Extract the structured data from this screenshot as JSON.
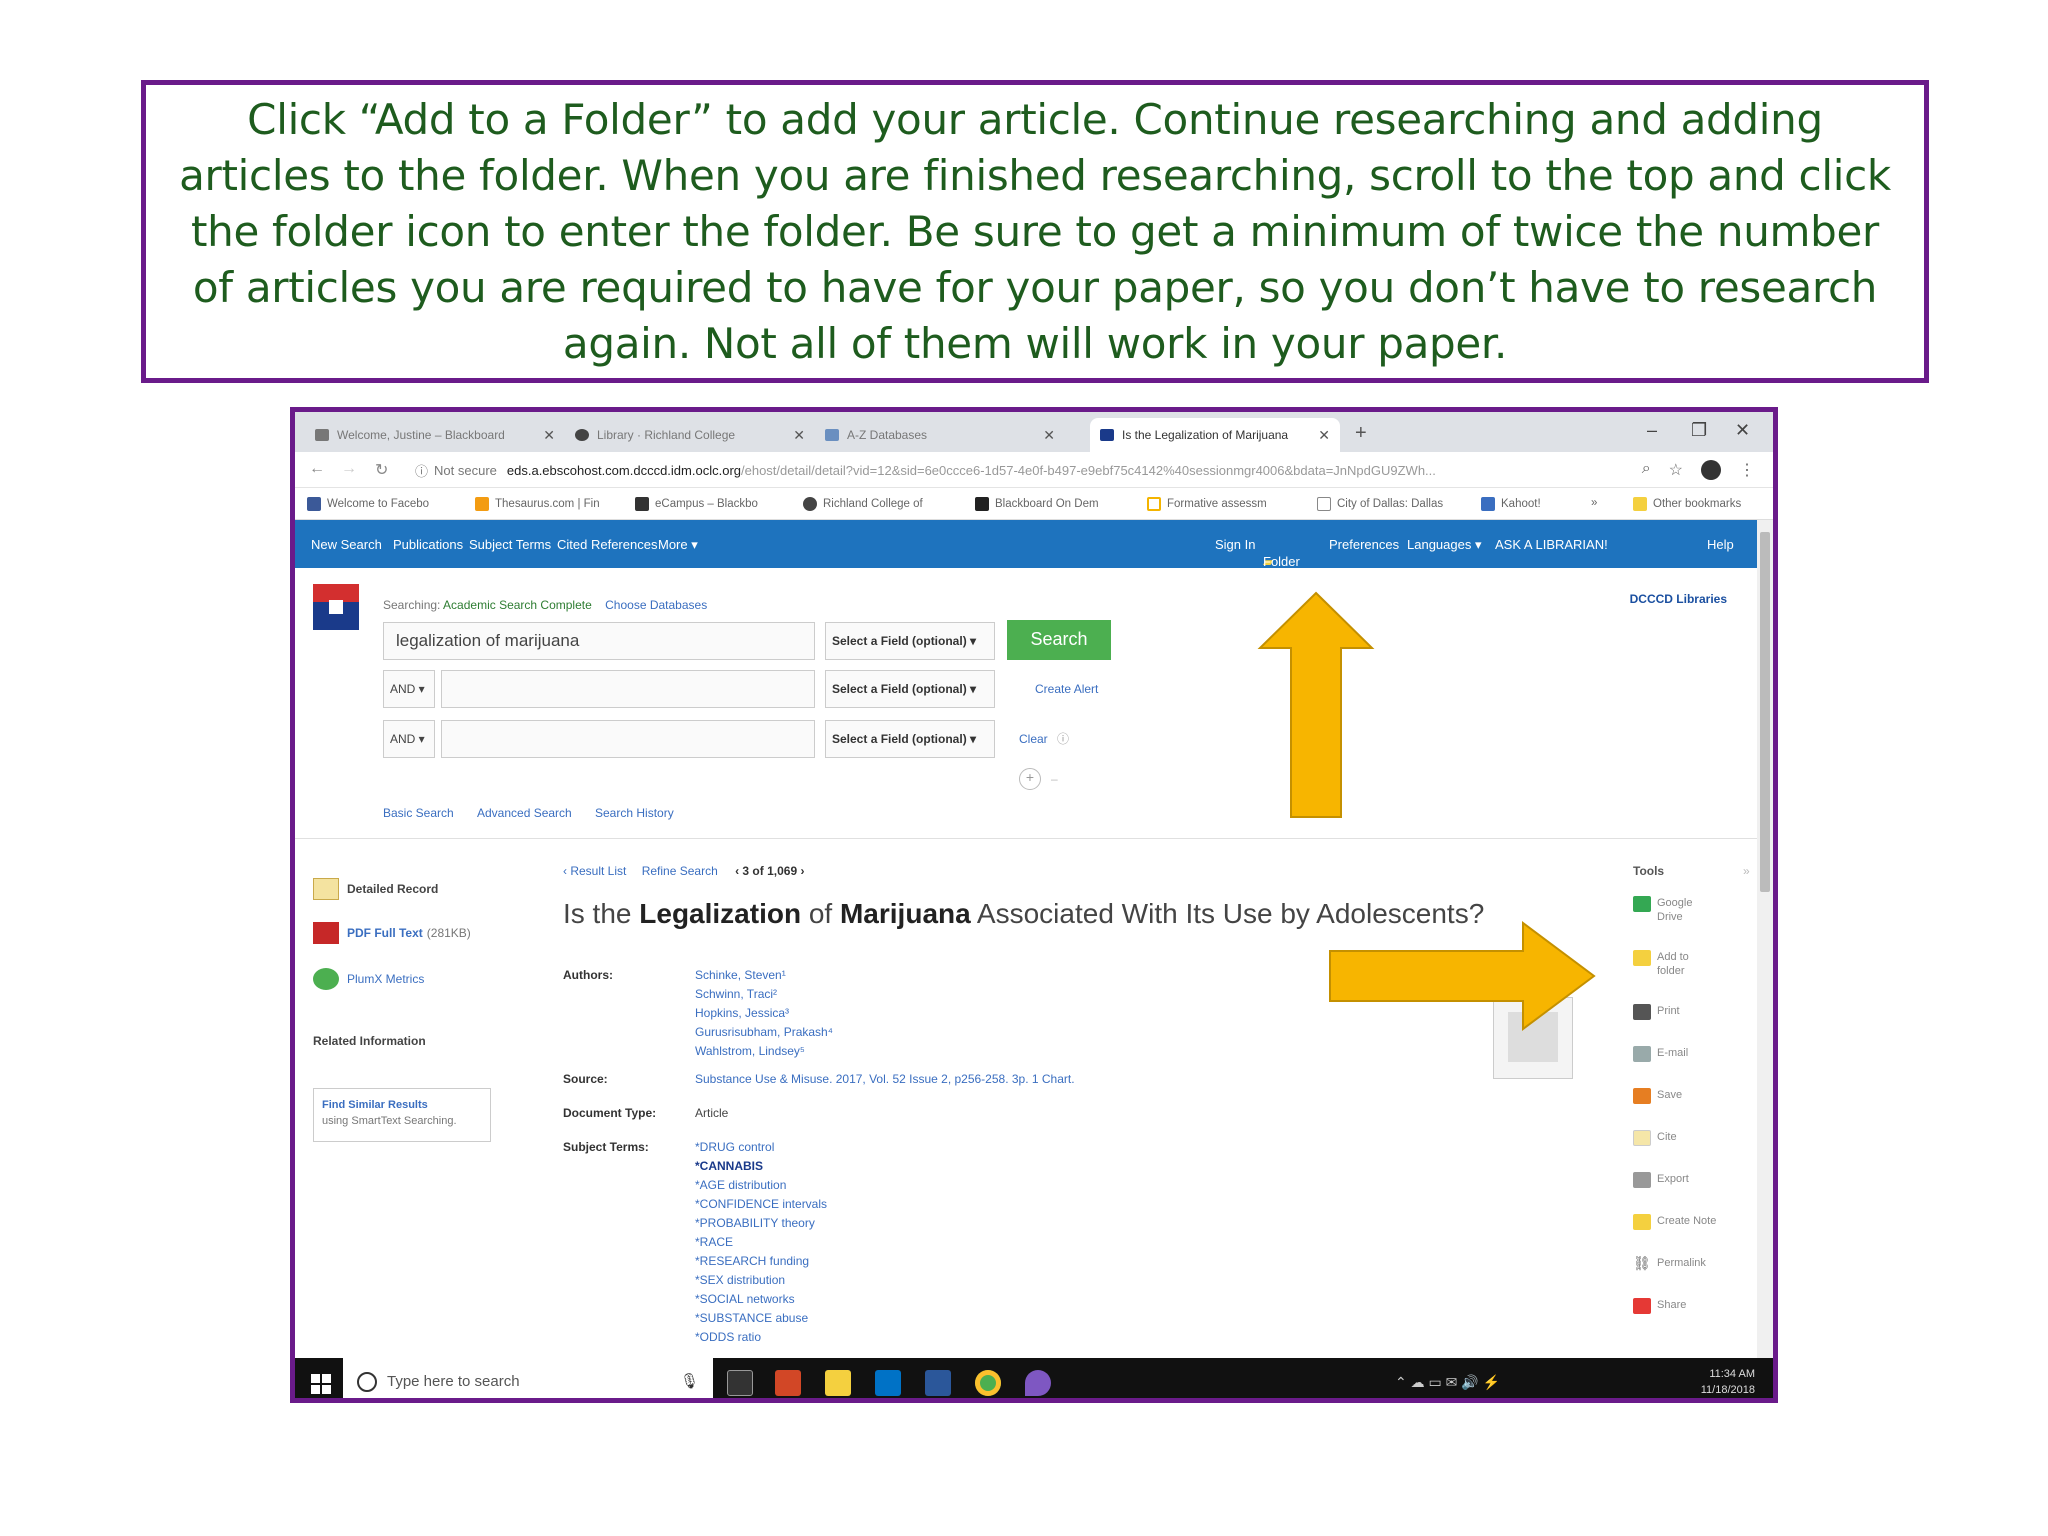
{
  "instruction": "Click “Add to a Folder” to add your article. Continue researching and adding articles to the folder. When you are finished researching, scroll to the top and click the folder icon to enter the folder. Be sure to get a minimum of twice the number of articles you are required to have for your paper, so you don’t have to research again. Not all of them will work in your paper.",
  "browser": {
    "tabs": [
      {
        "title": "Welcome, Justine – Blackboard"
      },
      {
        "title": "Library · Richland College"
      },
      {
        "title": "A-Z Databases"
      },
      {
        "title": "Is the Legalization of Marijuana"
      }
    ],
    "address": {
      "security": "Not secure",
      "host": "eds.a.ebscohost.com.dcccd.idm.oclc.org",
      "path": "/ehost/detail/detail?vid=12&sid=6e0ccce6-1d57-4e0f-b497-e9ebf75c4142%40sessionmgr4006&bdata=JnNpdGU9ZWh..."
    },
    "bookmarks": [
      "Welcome to Facebo",
      "Thesaurus.com | Fin",
      "eCampus – Blackbo",
      "Richland College of",
      "Blackboard On Dem",
      "Formative assessm",
      "City of Dallas: Dallas",
      "Kahoot!",
      "Other bookmarks"
    ]
  },
  "ebsco": {
    "nav_left": [
      "New Search",
      "Publications",
      "Subject Terms",
      "Cited References",
      "More ▾"
    ],
    "nav_right": [
      "Sign In",
      "Folder",
      "Preferences",
      "Languages ▾",
      "ASK A LIBRARIAN!",
      "Help"
    ],
    "searching_label": "Searching:",
    "database": "Academic Search Complete",
    "choose_db": "Choose Databases",
    "query": "legalization of marijuana",
    "field_select": "Select a Field (optional) ▾",
    "and_label": "AND ▾",
    "search_btn": "Search",
    "create_alert": "Create Alert",
    "clear": "Clear",
    "library": "DCCCD Libraries",
    "search_links": [
      "Basic Search",
      "Advanced Search",
      "Search History"
    ]
  },
  "sidebar": {
    "detailed_record": "Detailed Record",
    "pdf": "PDF Full Text",
    "pdf_size": "(281KB)",
    "plumx": "PlumX Metrics",
    "related": "Related Information",
    "find_similar": "Find Similar Results",
    "find_similar_sub": "using SmartText Searching."
  },
  "record": {
    "result_list": "‹ Result List",
    "refine": "Refine Search",
    "pager": "‹ 3 of 1,069 ›",
    "title_pre": "Is the ",
    "title_b1": "Legalization",
    "title_mid": " of ",
    "title_b2": "Marijuana",
    "title_post": " Associated With Its Use by Adolescents?",
    "authors_label": "Authors:",
    "authors": [
      "Schinke, Steven¹",
      "Schwinn, Traci²",
      "Hopkins, Jessica³",
      "Gurusrisubham, Prakash⁴",
      "Wahlstrom, Lindsey⁵"
    ],
    "source_label": "Source:",
    "source": "Substance Use & Misuse. 2017, Vol. 52 Issue 2, p256-258. 3p. 1 Chart.",
    "doctype_label": "Document Type:",
    "doctype": "Article",
    "subject_label": "Subject Terms:",
    "subjects": [
      "*DRUG control",
      "*CANNABIS",
      "*AGE distribution",
      "*CONFIDENCE intervals",
      "*PROBABILITY theory",
      "*RACE",
      "*RESEARCH funding",
      "*SEX distribution",
      "*SOCIAL networks",
      "*SUBSTANCE abuse",
      "*ODDS ratio"
    ]
  },
  "tools": {
    "heading": "Tools",
    "items": [
      "Google Drive",
      "Add to folder",
      "Print",
      "E-mail",
      "Save",
      "Cite",
      "Export",
      "Create Note",
      "Permalink",
      "Share"
    ]
  },
  "taskbar": {
    "search_placeholder": "Type here to search",
    "time": "11:34 AM",
    "date": "11/18/2018"
  },
  "colors": {
    "frame": "#6a1b8a",
    "instruction_text": "#1e5c1e",
    "ebsco_blue": "#1e73be",
    "arrow": "#f7b500"
  }
}
